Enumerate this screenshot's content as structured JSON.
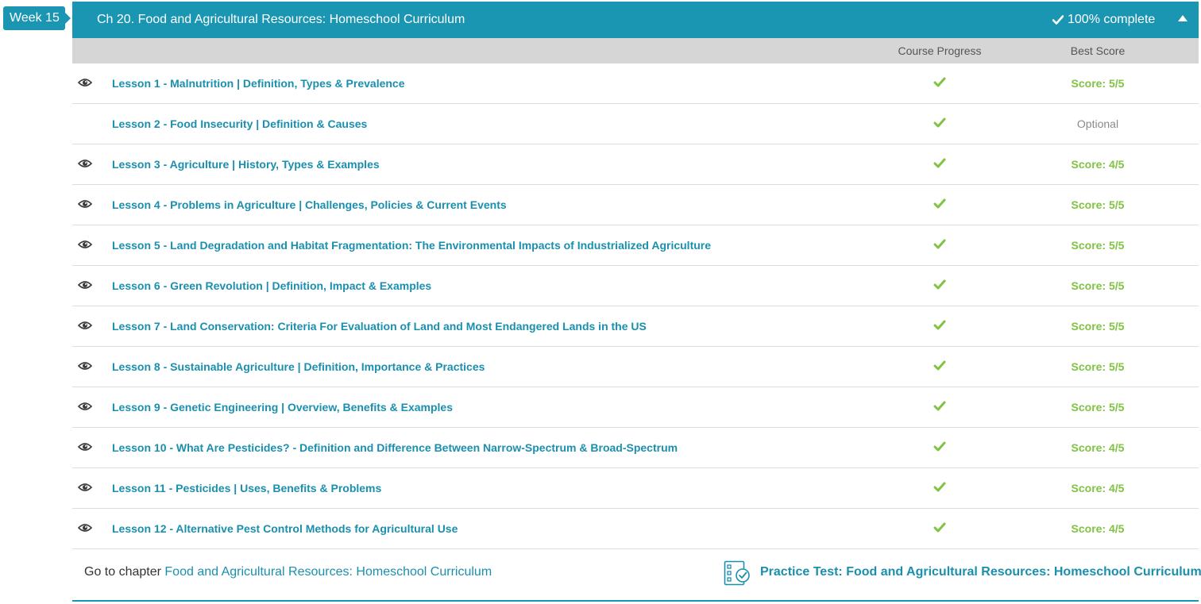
{
  "week_badge": {
    "label": "Week 15"
  },
  "chapter": {
    "title": "Ch 20. Food and Agricultural Resources: Homeschool Curriculum",
    "completion_text": "100% complete"
  },
  "columns": {
    "progress": "Course Progress",
    "score": "Best Score"
  },
  "lessons": [
    {
      "title": "Lesson 1 - Malnutrition | Definition, Types & Prevalence",
      "has_video": true,
      "completed": true,
      "score": "Score: 5/5"
    },
    {
      "title": "Lesson 2 - Food Insecurity | Definition & Causes",
      "has_video": false,
      "completed": true,
      "score": "Optional"
    },
    {
      "title": "Lesson 3 - Agriculture | History, Types & Examples",
      "has_video": true,
      "completed": true,
      "score": "Score: 4/5"
    },
    {
      "title": "Lesson 4 - Problems in Agriculture | Challenges, Policies & Current Events",
      "has_video": true,
      "completed": true,
      "score": "Score: 5/5"
    },
    {
      "title": "Lesson 5 - Land Degradation and Habitat Fragmentation: The Environmental Impacts of Industrialized Agriculture",
      "has_video": true,
      "completed": true,
      "score": "Score: 5/5"
    },
    {
      "title": "Lesson 6 - Green Revolution | Definition, Impact & Examples",
      "has_video": true,
      "completed": true,
      "score": "Score: 5/5"
    },
    {
      "title": "Lesson 7 - Land Conservation: Criteria For Evaluation of Land and Most Endangered Lands in the US",
      "has_video": true,
      "completed": true,
      "score": "Score: 5/5"
    },
    {
      "title": "Lesson 8 - Sustainable Agriculture | Definition, Importance & Practices",
      "has_video": true,
      "completed": true,
      "score": "Score: 5/5"
    },
    {
      "title": "Lesson 9 - Genetic Engineering | Overview, Benefits & Examples",
      "has_video": true,
      "completed": true,
      "score": "Score: 5/5"
    },
    {
      "title": "Lesson 10 - What Are Pesticides? - Definition and Difference Between Narrow-Spectrum & Broad-Spectrum",
      "has_video": true,
      "completed": true,
      "score": "Score: 4/5"
    },
    {
      "title": "Lesson 11 - Pesticides | Uses, Benefits & Problems",
      "has_video": true,
      "completed": true,
      "score": "Score: 4/5"
    },
    {
      "title": "Lesson 12 - Alternative Pest Control Methods for Agricultural Use",
      "has_video": true,
      "completed": true,
      "score": "Score: 4/5"
    }
  ],
  "footer": {
    "goto_prefix": "Go to chapter",
    "goto_link": "Food and Agricultural Resources: Homeschool Curriculum",
    "practice_test": "Practice Test: Food and Agricultural Resources: Homeschool Curriculum"
  },
  "colors": {
    "accent": "#1a96b3",
    "link": "#1a8fae",
    "success": "#80c342",
    "muted": "#8a8a8a"
  },
  "icons": {
    "lesson_video": "eye-icon",
    "lesson_complete": "checkmark-icon",
    "chapter_complete": "checkmark-icon",
    "collapse": "caret-up-icon",
    "practice_test": "checklist-icon"
  }
}
